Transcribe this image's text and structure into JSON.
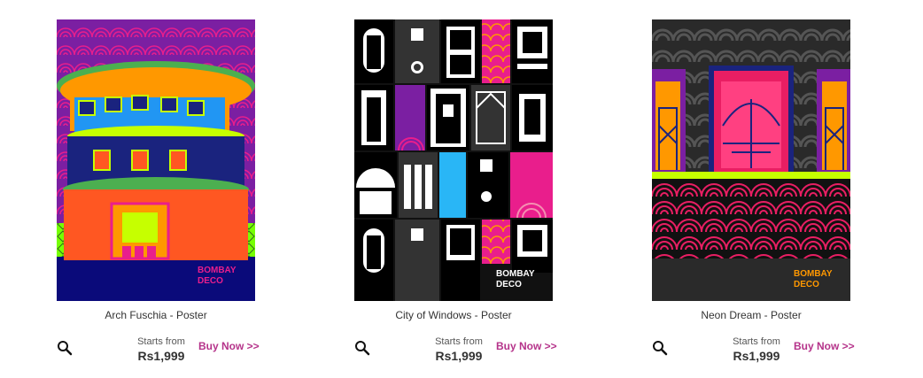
{
  "colors": {
    "accent": "#b5338a",
    "text": "#333333"
  },
  "products": [
    {
      "title": "Arch Fuschia - Poster",
      "starts_label": "Starts from",
      "price": "Rs1,999",
      "buy_label": "Buy Now >>",
      "zoom_icon": "magnifier-icon",
      "brand_line1": "BOMBAY",
      "brand_line2": "DECO"
    },
    {
      "title": "City of Windows - Poster",
      "starts_label": "Starts from",
      "price": "Rs1,999",
      "buy_label": "Buy Now >>",
      "zoom_icon": "magnifier-icon",
      "brand_line1": "BOMBAY",
      "brand_line2": "DECO"
    },
    {
      "title": "Neon Dream - Poster",
      "starts_label": "Starts from",
      "price": "Rs1,999",
      "buy_label": "Buy Now >>",
      "zoom_icon": "magnifier-icon",
      "brand_line1": "BOMBAY",
      "brand_line2": "DECO"
    }
  ]
}
